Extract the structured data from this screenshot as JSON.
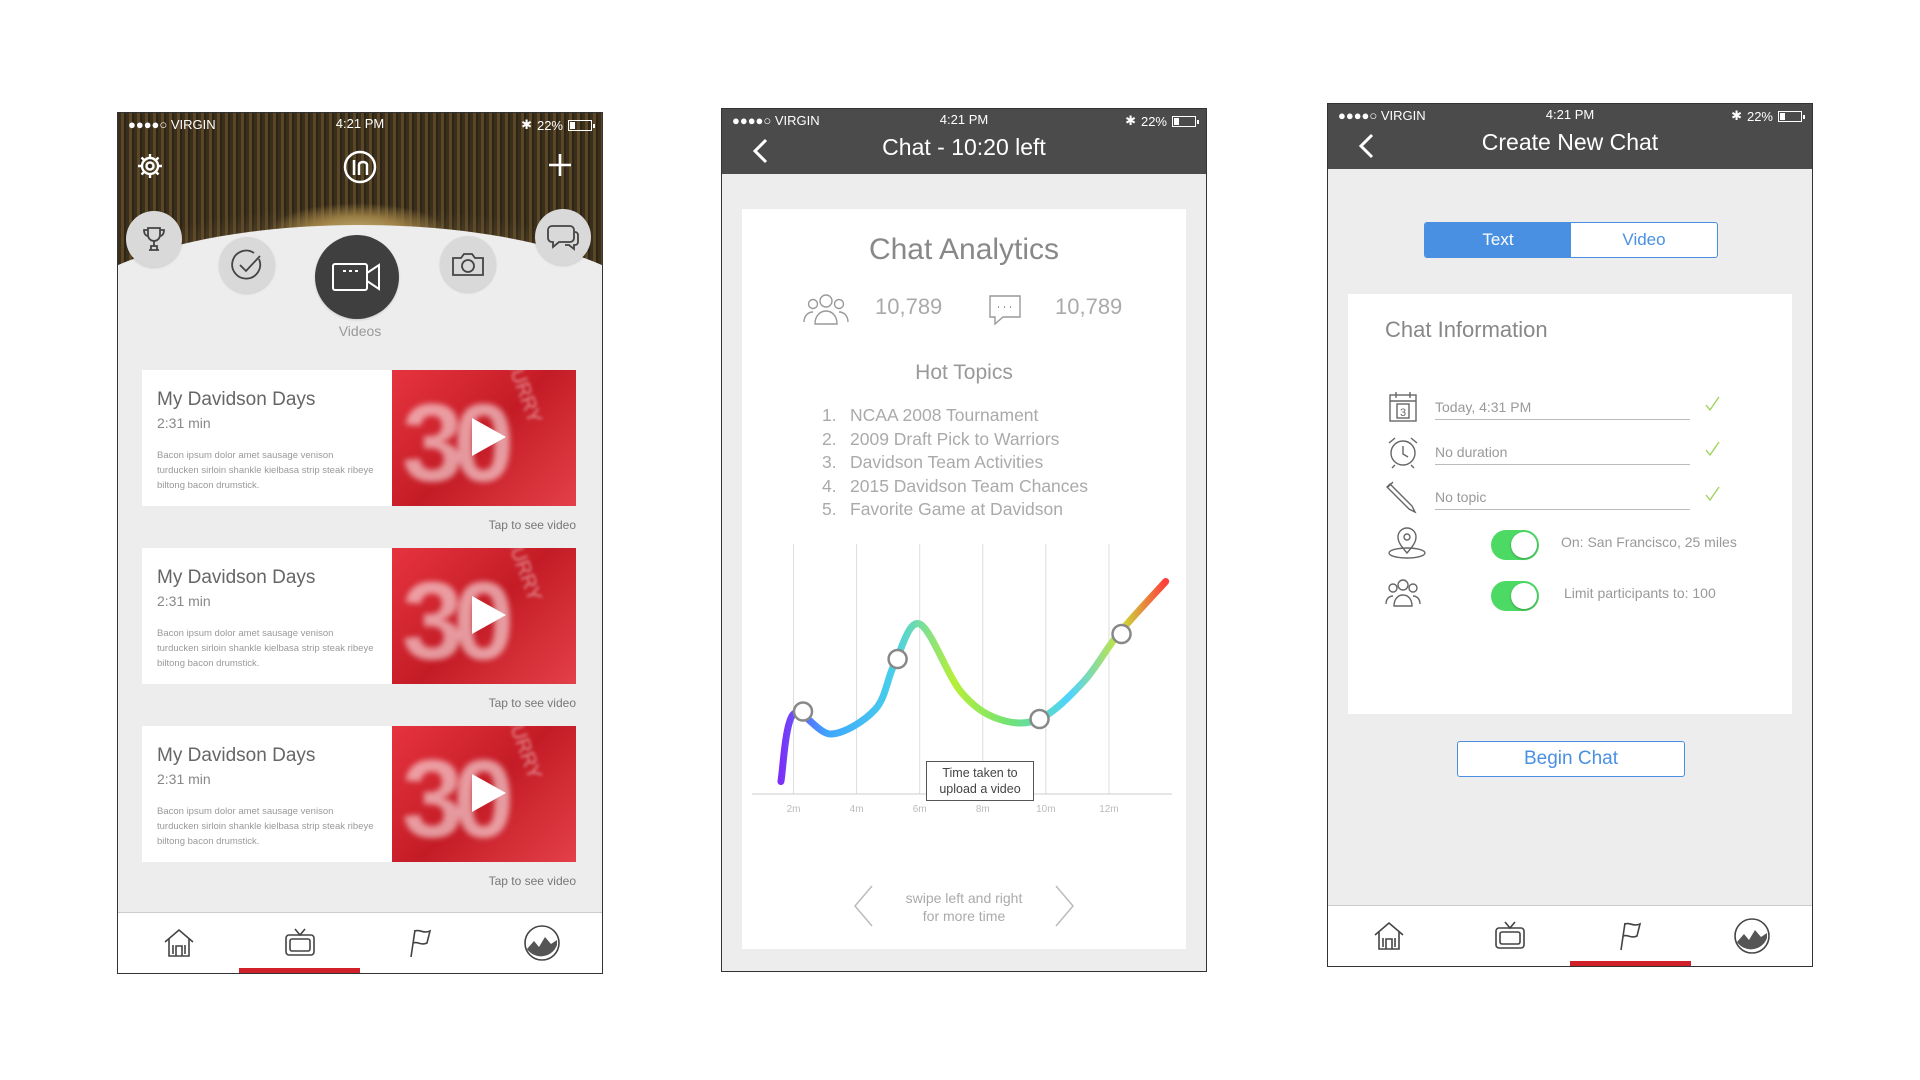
{
  "status": {
    "carrier": "●●●●○ VIRGIN",
    "time": "4:21 PM",
    "battery": "22%"
  },
  "screen1": {
    "section_label": "Videos",
    "videos": [
      {
        "title": "My Davidson Days",
        "duration": "2:31 min",
        "description": "Bacon ipsum dolor amet sausage venison turducken sirloin shankle kielbasa strip steak ribeye biltong bacon drumstick.",
        "jersey_name": "CURRY",
        "jersey_number": "30",
        "cta": "Tap to see video"
      },
      {
        "title": "My Davidson Days",
        "duration": "2:31 min",
        "description": "Bacon ipsum dolor amet sausage venison turducken sirloin shankle kielbasa strip steak ribeye biltong bacon drumstick.",
        "jersey_name": "CURRY",
        "jersey_number": "30",
        "cta": "Tap to see video"
      },
      {
        "title": "My Davidson Days",
        "duration": "2:31 min",
        "description": "Bacon ipsum dolor amet sausage venison turducken sirloin shankle kielbasa strip steak ribeye biltong bacon drumstick.",
        "jersey_name": "CURRY",
        "jersey_number": "30",
        "cta": "Tap to see video"
      }
    ],
    "tabs": [
      "home-icon",
      "tv-icon",
      "flag-icon",
      "stats-icon"
    ],
    "selected_tab": 1
  },
  "screen2": {
    "title": "Chat - 10:20 left",
    "card_title": "Chat Analytics",
    "participants_count": "10,789",
    "messages_count": "10,789",
    "hot_topics_title": "Hot Topics",
    "hot_topics": [
      {
        "n": "1.",
        "text": "NCAA 2008 Tournament"
      },
      {
        "n": "2.",
        "text": "2009 Draft Pick to Warriors"
      },
      {
        "n": "3.",
        "text": "Davidson Team Activities"
      },
      {
        "n": "4.",
        "text": "2015 Davidson Team Chances"
      },
      {
        "n": "5.",
        "text": "Favorite Game at Davidson"
      }
    ],
    "tooltip_line1": "Time taken to",
    "tooltip_line2": "upload a video",
    "swipe_line1": "swipe left and right",
    "swipe_line2": "for more time"
  },
  "chart_data": {
    "type": "line",
    "x_ticks": [
      "2m",
      "4m",
      "6m",
      "8m",
      "10m",
      "12m"
    ],
    "x_tick_values": [
      2,
      4,
      6,
      8,
      10,
      12
    ],
    "xlim": [
      1,
      14
    ],
    "ylim": [
      0,
      100
    ],
    "x": [
      1.6,
      2.0,
      3.2,
      4.6,
      5.2,
      6.0,
      7.3,
      8.5,
      9.8,
      11.2,
      12.3,
      13.8
    ],
    "y": [
      5,
      32,
      24,
      34,
      52,
      68,
      41,
      30,
      30,
      45,
      64,
      85
    ],
    "markers_x": [
      2.3,
      5.3,
      9.8,
      12.4
    ],
    "markers_y": [
      33,
      54,
      30,
      64
    ],
    "grid": "vertical",
    "legend": "none"
  },
  "screen3": {
    "title": "Create New Chat",
    "segments": [
      "Text",
      "Video"
    ],
    "selected_segment": 0,
    "card_title": "Chat Information",
    "calendar_day": "3",
    "date_value": "Today, 4:31 PM",
    "duration_value": "No duration",
    "topic_value": "No topic",
    "location_label": "On: San Francisco, 25 miles",
    "participants_label": "Limit participants to: 100",
    "begin_button": "Begin Chat",
    "selected_tab": 2
  },
  "colors": {
    "accent_red": "#d0202a",
    "accent_blue": "#4a90e2",
    "toggle_green": "#4cd964",
    "header_dark": "#4b4b4b"
  }
}
